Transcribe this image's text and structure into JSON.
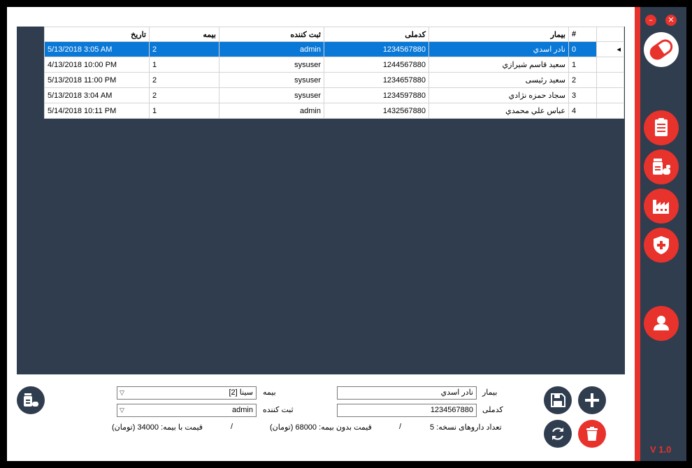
{
  "window": {
    "minimize_glyph": "–",
    "close_glyph": "✕",
    "version": "V 1.0"
  },
  "sidebar": {
    "logo_icon": "pill-capsule-icon",
    "items": [
      {
        "icon": "clipboard-list-icon"
      },
      {
        "icon": "medicine-bottles-icon"
      },
      {
        "icon": "factory-icon"
      },
      {
        "icon": "shield-plus-icon"
      },
      {
        "icon": "user-icon"
      }
    ]
  },
  "colors": {
    "accent": "#e8322c",
    "sidebar": "#2f3d4f",
    "selection": "#0a78d7"
  },
  "grid": {
    "columns": [
      "#",
      "بيمار",
      "کدملی",
      "ثبت کننده",
      "بیمه",
      "تاريخ"
    ],
    "rows": [
      {
        "id": "0",
        "patient": "نادر اسدي",
        "national_code": "1234567880",
        "registrar": "admin",
        "insurance": "2",
        "date": "5/13/2018 3:05 AM",
        "selected": true
      },
      {
        "id": "1",
        "patient": "سعيد قاسم شيرازي",
        "national_code": "1244567880",
        "registrar": "sysuser",
        "insurance": "1",
        "date": "4/13/2018 10:00 PM",
        "selected": false
      },
      {
        "id": "2",
        "patient": "سعید رئیسی",
        "national_code": "1234657880",
        "registrar": "sysuser",
        "insurance": "2",
        "date": "5/13/2018 11:00 PM",
        "selected": false
      },
      {
        "id": "3",
        "patient": "سجاد حمزه نژادي",
        "national_code": "1234597880",
        "registrar": "sysuser",
        "insurance": "2",
        "date": "5/13/2018 3:04 AM",
        "selected": false
      },
      {
        "id": "4",
        "patient": "عباس علي محمدي",
        "national_code": "1432567880",
        "registrar": "admin",
        "insurance": "1",
        "date": "5/14/2018 10:11 PM",
        "selected": false
      }
    ]
  },
  "form": {
    "patient_label": "بیمار",
    "patient_value": "نادر اسدي",
    "national_code_label": "کدملی",
    "national_code_value": "1234567880",
    "insurance_label": "بیمه",
    "insurance_value": "[2] سینا",
    "registrar_label": "ثبت کننده",
    "registrar_value": "admin",
    "drug_count_text": "تعداد داروهای نسخه: 5",
    "price_without_insurance_text": "قیمت بدون بیمه: 68000 (تومان)",
    "price_with_insurance_text": "قیمت با بیمه: 34000 (تومان)",
    "separator": "/"
  },
  "actions": {
    "save_icon": "save-icon",
    "add_icon": "plus-icon",
    "refresh_icon": "refresh-icon",
    "delete_icon": "trash-icon",
    "drugs_icon": "medicine-bottles-icon"
  }
}
